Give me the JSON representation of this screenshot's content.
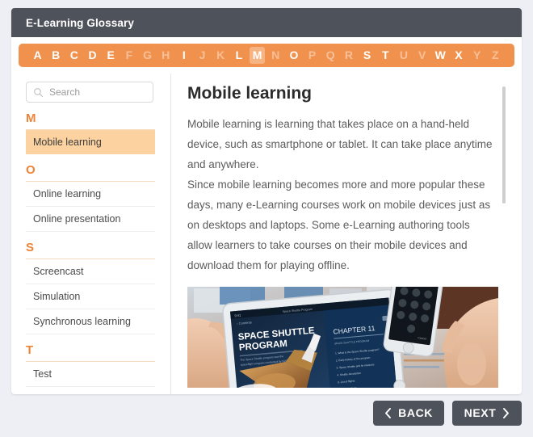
{
  "header": {
    "title": "E-Learning Glossary"
  },
  "alphabet": {
    "letters": [
      {
        "ch": "A",
        "state": "active"
      },
      {
        "ch": "B",
        "state": "active"
      },
      {
        "ch": "C",
        "state": "active"
      },
      {
        "ch": "D",
        "state": "active"
      },
      {
        "ch": "E",
        "state": "active"
      },
      {
        "ch": "F",
        "state": "inactive"
      },
      {
        "ch": "G",
        "state": "inactive"
      },
      {
        "ch": "H",
        "state": "inactive"
      },
      {
        "ch": "I",
        "state": "active"
      },
      {
        "ch": "J",
        "state": "inactive"
      },
      {
        "ch": "K",
        "state": "inactive"
      },
      {
        "ch": "L",
        "state": "active"
      },
      {
        "ch": "M",
        "state": "selected"
      },
      {
        "ch": "N",
        "state": "inactive"
      },
      {
        "ch": "O",
        "state": "active"
      },
      {
        "ch": "P",
        "state": "inactive"
      },
      {
        "ch": "Q",
        "state": "inactive"
      },
      {
        "ch": "R",
        "state": "inactive"
      },
      {
        "ch": "S",
        "state": "active"
      },
      {
        "ch": "T",
        "state": "active"
      },
      {
        "ch": "U",
        "state": "inactive"
      },
      {
        "ch": "V",
        "state": "inactive"
      },
      {
        "ch": "W",
        "state": "active"
      },
      {
        "ch": "X",
        "state": "active"
      },
      {
        "ch": "Y",
        "state": "inactive"
      },
      {
        "ch": "Z",
        "state": "inactive"
      }
    ],
    "bar_color": "#f0924e",
    "selected_bg": "#f7b483"
  },
  "sidebar": {
    "search": {
      "placeholder": "Search",
      "value": "",
      "icon": "search-icon"
    },
    "sections": [
      {
        "letter": "M",
        "terms": [
          {
            "label": "Mobile learning",
            "selected": true
          }
        ]
      },
      {
        "letter": "O",
        "terms": [
          {
            "label": "Online learning",
            "selected": false
          },
          {
            "label": "Online presentation",
            "selected": false
          }
        ]
      },
      {
        "letter": "S",
        "terms": [
          {
            "label": "Screencast",
            "selected": false
          },
          {
            "label": "Simulation",
            "selected": false
          },
          {
            "label": "Synchronous learning",
            "selected": false
          }
        ]
      },
      {
        "letter": "T",
        "terms": [
          {
            "label": "Test",
            "selected": false
          }
        ]
      }
    ]
  },
  "content": {
    "title": "Mobile learning",
    "paragraphs": [
      "Mobile learning is learning that takes place on a hand-held device, such as smartphone or tablet. It can take place anytime and anywhere.",
      "Since mobile learning becomes more and more popular these days, many e-Learning courses work on mobile devices just as on desktops and laptops. Some e-Learning authoring tools allow learners to take courses on their mobile devices and download them for playing offline."
    ],
    "figure": {
      "alt": "Hands holding a tablet and a smartphone showing an e-learning course",
      "tablet_title": "SPACE SHUTTLE PROGRAM",
      "tablet_chapter": "CHAPTER 11",
      "tablet_subtitle": "SPACE SHUTTLE PROGRAM"
    }
  },
  "footer": {
    "back_label": "BACK",
    "next_label": "NEXT"
  },
  "colors": {
    "header_bg": "#4e525b",
    "accent_orange": "#ee8336",
    "bar_orange": "#f0924e",
    "selected_term_bg": "#fbd2a0",
    "page_bg": "#edeff4"
  }
}
